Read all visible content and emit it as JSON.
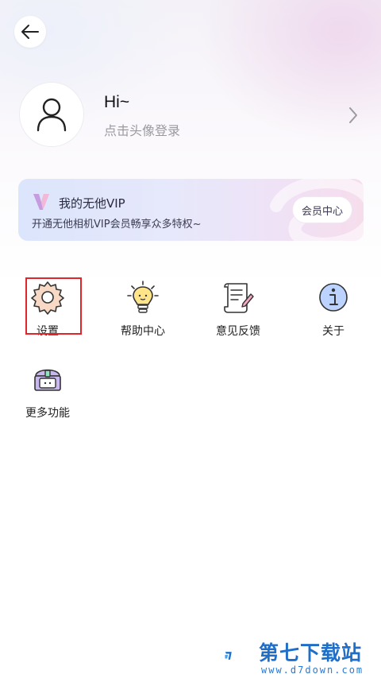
{
  "profile": {
    "greeting": "Hi~",
    "login_hint": "点击头像登录"
  },
  "vip": {
    "title": "我的无他VIP",
    "subtitle": "开通无他相机VIP会员畅享众多特权~",
    "button": "会员中心"
  },
  "menu": {
    "items": [
      {
        "label": "设置",
        "icon": "gear-icon"
      },
      {
        "label": "帮助中心",
        "icon": "lightbulb-icon"
      },
      {
        "label": "意见反馈",
        "icon": "feedback-scroll-icon"
      },
      {
        "label": "关于",
        "icon": "info-icon"
      },
      {
        "label": "更多功能",
        "icon": "treasure-chest-icon"
      }
    ]
  },
  "watermark": {
    "name": "第七下载站",
    "url": "www.d7down.com"
  },
  "colors": {
    "highlight": "#e0262a",
    "watermark": "#1f6fc9"
  }
}
